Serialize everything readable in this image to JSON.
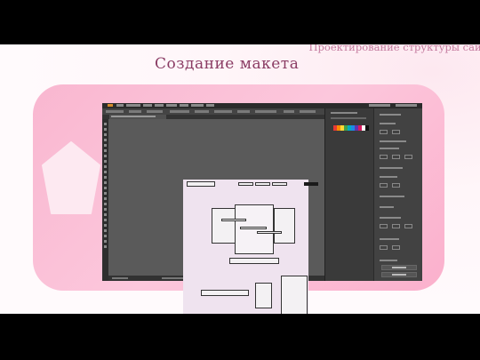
{
  "slide": {
    "subtitle": "Проектирование структуры сайт",
    "title": "Создание макета",
    "colors": {
      "title": "#8a3c64",
      "subtitle": "#c47a9e",
      "card": "#fbb9d1",
      "pentagon": "#fde9f1"
    }
  },
  "screenshot": {
    "app": "Adobe Illustrator",
    "interface_theme": "dark",
    "artboard_labels": {
      "logo_box": "",
      "center_caption": ""
    }
  }
}
